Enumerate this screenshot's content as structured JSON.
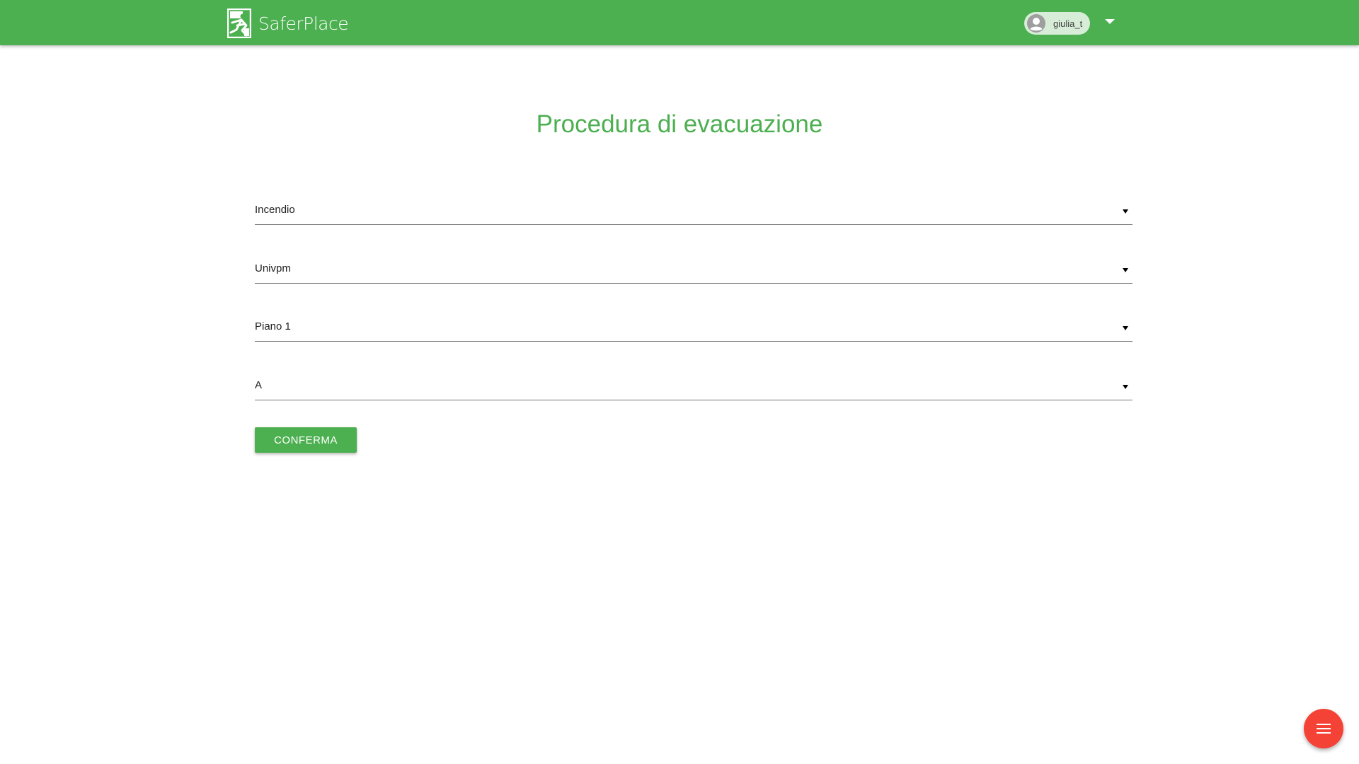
{
  "app": {
    "brand_name": "SaferPlace",
    "accent_color": "#4caf50",
    "fab_color": "#f44336"
  },
  "user": {
    "name": "giulia_t",
    "avatar_icon": "account-circle-icon",
    "menu_icon": "caret-down-icon"
  },
  "page": {
    "title": "Procedura di evacuazione"
  },
  "form": {
    "fields": [
      {
        "value": "Incendio"
      },
      {
        "value": "Univpm"
      },
      {
        "value": "Piano 1"
      },
      {
        "value": "A"
      }
    ],
    "confirm_label": "CONFERMA"
  },
  "fab": {
    "icon": "menu-icon"
  }
}
